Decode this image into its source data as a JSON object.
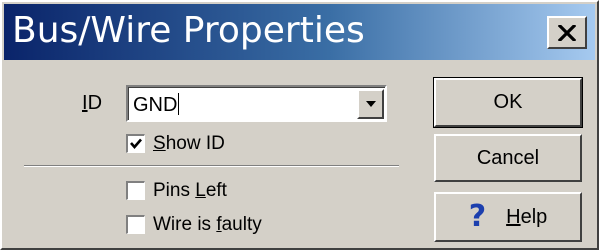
{
  "dialog": {
    "title": "Bus/Wire Properties"
  },
  "id_field": {
    "label_mnemonic": "I",
    "label_rest": "D",
    "value": "GND"
  },
  "options": {
    "show_id": {
      "mnemonic": "S",
      "rest": "how ID",
      "checked": true
    },
    "pins_left": {
      "before": "Pins ",
      "mnemonic": "L",
      "rest": "eft",
      "checked": false
    },
    "wire_is_faulty": {
      "before": "Wire is ",
      "mnemonic": "f",
      "rest": "aulty",
      "checked": false
    }
  },
  "buttons": {
    "ok": "OK",
    "cancel": "Cancel",
    "help_mnemonic": "H",
    "help_rest": "elp"
  },
  "icons": {
    "close": "close-icon",
    "dropdown": "chevron-down-icon",
    "check": "check-icon",
    "help": "question-mark-icon"
  }
}
